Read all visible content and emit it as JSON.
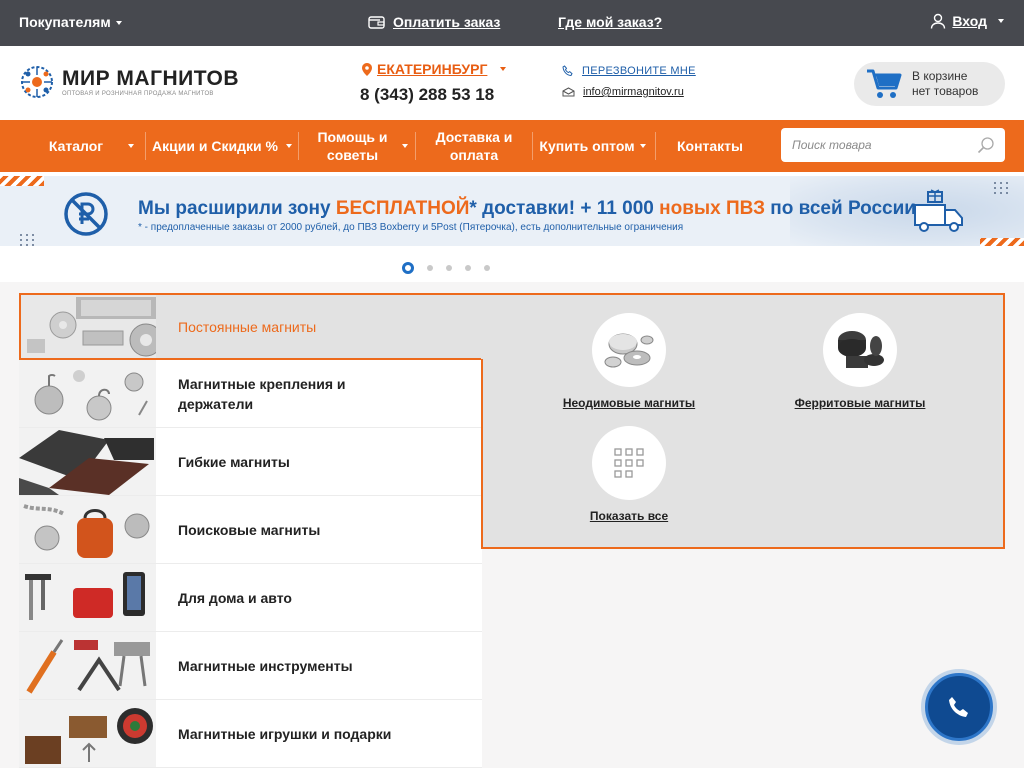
{
  "topbar": {
    "buyers": "Покупателям",
    "pay_order": "Оплатить заказ",
    "where_order": "Где мой заказ?",
    "login": "Вход"
  },
  "header": {
    "logo_title": "МИР МАГНИТОВ",
    "logo_subtitle": "ОПТОВАЯ И РОЗНИЧНАЯ ПРОДАЖА МАГНИТОВ",
    "city": "ЕКАТЕРИНБУРГ",
    "phone": "8 (343) 288 53 18",
    "callback": "ПЕРЕЗВОНИТЕ МНЕ",
    "email": "info@mirmagnitov.ru",
    "cart_line1": "В корзине",
    "cart_line2": "нет товаров"
  },
  "nav": {
    "items": [
      {
        "label": "Каталог"
      },
      {
        "label": "Акции и Скидки %"
      },
      {
        "label": "Помощь и советы"
      },
      {
        "label": "Доставка и оплата"
      },
      {
        "label": "Купить оптом"
      },
      {
        "label": "Контакты"
      }
    ],
    "search_placeholder": "Поиск товара"
  },
  "banner": {
    "title_part1": "Мы расширили зону ",
    "title_accent1": "БЕСПЛАТНОЙ",
    "title_part2": "* доставки! + 11 000 ",
    "title_accent2": "новых ПВЗ",
    "title_part3": " по всей России",
    "subtitle": "* - предоплаченные заказы от 2000 рублей, до ПВЗ Boxberry и 5Post (Пятерочка), есть дополнительные ограничения",
    "slides_count": 5,
    "active_slide": 1
  },
  "categories": [
    {
      "label": "Постоянные магниты",
      "active": true
    },
    {
      "label": "Магнитные крепления и держатели",
      "active": false
    },
    {
      "label": "Гибкие магниты",
      "active": false
    },
    {
      "label": "Поисковые магниты",
      "active": false
    },
    {
      "label": "Для дома и авто",
      "active": false
    },
    {
      "label": "Магнитные инструменты",
      "active": false
    },
    {
      "label": "Магнитные игрушки и подарки",
      "active": false
    }
  ],
  "subcategories": [
    {
      "label": "Неодимовые магниты"
    },
    {
      "label": "Ферритовые магниты"
    },
    {
      "label": "Показать все"
    }
  ],
  "colors": {
    "accent": "#ed6a1c",
    "brand_blue": "#1f5fa9",
    "topbar": "#47494f",
    "fab": "#0f4a91"
  }
}
